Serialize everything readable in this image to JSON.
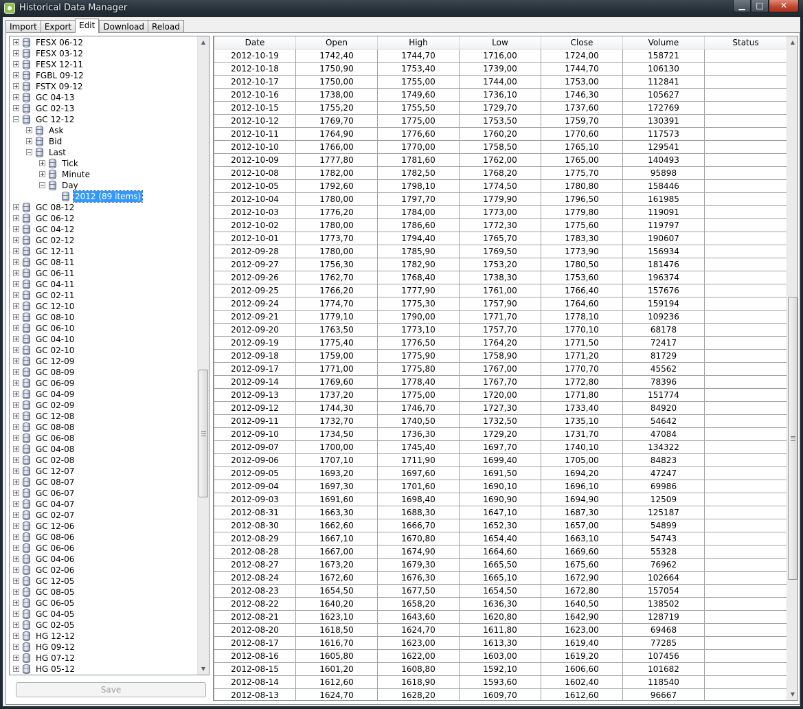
{
  "window": {
    "title": "Historical Data Manager",
    "min_glyph": "▁",
    "max_glyph": "□",
    "close_glyph": "✕"
  },
  "tabs": [
    {
      "label": "Import",
      "active": false
    },
    {
      "label": "Export",
      "active": false
    },
    {
      "label": "Edit",
      "active": true
    },
    {
      "label": "Download",
      "active": false
    },
    {
      "label": "Reload",
      "active": false
    }
  ],
  "tree": {
    "nodes": [
      {
        "label": "FESX 06-12",
        "level": 0,
        "expander": "plus"
      },
      {
        "label": "FESX 03-12",
        "level": 0,
        "expander": "plus"
      },
      {
        "label": "FESX 12-11",
        "level": 0,
        "expander": "plus"
      },
      {
        "label": "FGBL 09-12",
        "level": 0,
        "expander": "plus"
      },
      {
        "label": "FSTX 09-12",
        "level": 0,
        "expander": "plus"
      },
      {
        "label": "GC 04-13",
        "level": 0,
        "expander": "plus"
      },
      {
        "label": "GC 02-13",
        "level": 0,
        "expander": "plus"
      },
      {
        "label": "GC 12-12",
        "level": 0,
        "expander": "minus"
      },
      {
        "label": "Ask",
        "level": 1,
        "expander": "plus"
      },
      {
        "label": "Bid",
        "level": 1,
        "expander": "plus"
      },
      {
        "label": "Last",
        "level": 1,
        "expander": "minus"
      },
      {
        "label": "Tick",
        "level": 2,
        "expander": "plus"
      },
      {
        "label": "Minute",
        "level": 2,
        "expander": "plus"
      },
      {
        "label": "Day",
        "level": 2,
        "expander": "minus"
      },
      {
        "label": "2012 (89 items)",
        "level": 3,
        "expander": "none",
        "selected": true
      },
      {
        "label": "GC 08-12",
        "level": 0,
        "expander": "plus"
      },
      {
        "label": "GC 06-12",
        "level": 0,
        "expander": "plus"
      },
      {
        "label": "GC 04-12",
        "level": 0,
        "expander": "plus"
      },
      {
        "label": "GC 02-12",
        "level": 0,
        "expander": "plus"
      },
      {
        "label": "GC 12-11",
        "level": 0,
        "expander": "plus"
      },
      {
        "label": "GC 08-11",
        "level": 0,
        "expander": "plus"
      },
      {
        "label": "GC 06-11",
        "level": 0,
        "expander": "plus"
      },
      {
        "label": "GC 04-11",
        "level": 0,
        "expander": "plus"
      },
      {
        "label": "GC 02-11",
        "level": 0,
        "expander": "plus"
      },
      {
        "label": "GC 12-10",
        "level": 0,
        "expander": "plus"
      },
      {
        "label": "GC 08-10",
        "level": 0,
        "expander": "plus"
      },
      {
        "label": "GC 06-10",
        "level": 0,
        "expander": "plus"
      },
      {
        "label": "GC 04-10",
        "level": 0,
        "expander": "plus"
      },
      {
        "label": "GC 02-10",
        "level": 0,
        "expander": "plus"
      },
      {
        "label": "GC 12-09",
        "level": 0,
        "expander": "plus"
      },
      {
        "label": "GC 08-09",
        "level": 0,
        "expander": "plus"
      },
      {
        "label": "GC 06-09",
        "level": 0,
        "expander": "plus"
      },
      {
        "label": "GC 04-09",
        "level": 0,
        "expander": "plus"
      },
      {
        "label": "GC 02-09",
        "level": 0,
        "expander": "plus"
      },
      {
        "label": "GC 12-08",
        "level": 0,
        "expander": "plus"
      },
      {
        "label": "GC 08-08",
        "level": 0,
        "expander": "plus"
      },
      {
        "label": "GC 06-08",
        "level": 0,
        "expander": "plus"
      },
      {
        "label": "GC 04-08",
        "level": 0,
        "expander": "plus"
      },
      {
        "label": "GC 02-08",
        "level": 0,
        "expander": "plus"
      },
      {
        "label": "GC 12-07",
        "level": 0,
        "expander": "plus"
      },
      {
        "label": "GC 08-07",
        "level": 0,
        "expander": "plus"
      },
      {
        "label": "GC 06-07",
        "level": 0,
        "expander": "plus"
      },
      {
        "label": "GC 04-07",
        "level": 0,
        "expander": "plus"
      },
      {
        "label": "GC 02-07",
        "level": 0,
        "expander": "plus"
      },
      {
        "label": "GC 12-06",
        "level": 0,
        "expander": "plus"
      },
      {
        "label": "GC 08-06",
        "level": 0,
        "expander": "plus"
      },
      {
        "label": "GC 06-06",
        "level": 0,
        "expander": "plus"
      },
      {
        "label": "GC 04-06",
        "level": 0,
        "expander": "plus"
      },
      {
        "label": "GC 02-06",
        "level": 0,
        "expander": "plus"
      },
      {
        "label": "GC 12-05",
        "level": 0,
        "expander": "plus"
      },
      {
        "label": "GC 08-05",
        "level": 0,
        "expander": "plus"
      },
      {
        "label": "GC 06-05",
        "level": 0,
        "expander": "plus"
      },
      {
        "label": "GC 04-05",
        "level": 0,
        "expander": "plus"
      },
      {
        "label": "GC 02-05",
        "level": 0,
        "expander": "plus"
      },
      {
        "label": "HG 12-12",
        "level": 0,
        "expander": "plus"
      },
      {
        "label": "HG 09-12",
        "level": 0,
        "expander": "plus"
      },
      {
        "label": "HG 07-12",
        "level": 0,
        "expander": "plus"
      },
      {
        "label": "HG 05-12",
        "level": 0,
        "expander": "plus"
      }
    ]
  },
  "save_button": {
    "label": "Save",
    "enabled": false
  },
  "grid": {
    "columns": [
      "Date",
      "Open",
      "High",
      "Low",
      "Close",
      "Volume",
      "Status"
    ],
    "rows": [
      [
        "2012-10-19",
        "1742,40",
        "1744,70",
        "1716,00",
        "1724,00",
        "158721",
        ""
      ],
      [
        "2012-10-18",
        "1750,90",
        "1753,40",
        "1739,00",
        "1744,70",
        "106130",
        ""
      ],
      [
        "2012-10-17",
        "1750,00",
        "1755,00",
        "1744,00",
        "1753,00",
        "112841",
        ""
      ],
      [
        "2012-10-16",
        "1738,00",
        "1749,60",
        "1736,10",
        "1746,30",
        "105627",
        ""
      ],
      [
        "2012-10-15",
        "1755,20",
        "1755,50",
        "1729,70",
        "1737,60",
        "172769",
        ""
      ],
      [
        "2012-10-12",
        "1769,70",
        "1775,00",
        "1753,50",
        "1759,70",
        "130391",
        ""
      ],
      [
        "2012-10-11",
        "1764,90",
        "1776,60",
        "1760,20",
        "1770,60",
        "117573",
        ""
      ],
      [
        "2012-10-10",
        "1766,00",
        "1770,00",
        "1758,50",
        "1765,10",
        "129541",
        ""
      ],
      [
        "2012-10-09",
        "1777,80",
        "1781,60",
        "1762,00",
        "1765,00",
        "140493",
        ""
      ],
      [
        "2012-10-08",
        "1782,00",
        "1782,50",
        "1768,20",
        "1775,70",
        "95898",
        ""
      ],
      [
        "2012-10-05",
        "1792,60",
        "1798,10",
        "1774,50",
        "1780,80",
        "158446",
        ""
      ],
      [
        "2012-10-04",
        "1780,00",
        "1797,70",
        "1779,90",
        "1796,50",
        "161985",
        ""
      ],
      [
        "2012-10-03",
        "1776,20",
        "1784,00",
        "1773,00",
        "1779,80",
        "119091",
        ""
      ],
      [
        "2012-10-02",
        "1780,00",
        "1786,60",
        "1772,30",
        "1775,60",
        "119797",
        ""
      ],
      [
        "2012-10-01",
        "1773,70",
        "1794,40",
        "1765,70",
        "1783,30",
        "190607",
        ""
      ],
      [
        "2012-09-28",
        "1780,00",
        "1785,90",
        "1769,50",
        "1773,90",
        "156934",
        ""
      ],
      [
        "2012-09-27",
        "1756,30",
        "1782,90",
        "1753,20",
        "1780,50",
        "181476",
        ""
      ],
      [
        "2012-09-26",
        "1762,70",
        "1768,40",
        "1738,30",
        "1753,60",
        "196374",
        ""
      ],
      [
        "2012-09-25",
        "1766,20",
        "1777,90",
        "1761,00",
        "1766,40",
        "157676",
        ""
      ],
      [
        "2012-09-24",
        "1774,70",
        "1775,30",
        "1757,90",
        "1764,60",
        "159194",
        ""
      ],
      [
        "2012-09-21",
        "1779,10",
        "1790,00",
        "1771,70",
        "1778,10",
        "109236",
        ""
      ],
      [
        "2012-09-20",
        "1763,50",
        "1773,10",
        "1757,70",
        "1770,10",
        "68178",
        ""
      ],
      [
        "2012-09-19",
        "1775,40",
        "1776,50",
        "1764,20",
        "1771,50",
        "72417",
        ""
      ],
      [
        "2012-09-18",
        "1759,00",
        "1775,90",
        "1758,90",
        "1771,20",
        "81729",
        ""
      ],
      [
        "2012-09-17",
        "1771,00",
        "1775,80",
        "1767,00",
        "1770,70",
        "45562",
        ""
      ],
      [
        "2012-09-14",
        "1769,60",
        "1778,40",
        "1767,70",
        "1772,80",
        "78396",
        ""
      ],
      [
        "2012-09-13",
        "1737,20",
        "1775,00",
        "1720,00",
        "1771,80",
        "151774",
        ""
      ],
      [
        "2012-09-12",
        "1744,30",
        "1746,70",
        "1727,30",
        "1733,40",
        "84920",
        ""
      ],
      [
        "2012-09-11",
        "1732,70",
        "1740,50",
        "1732,50",
        "1735,10",
        "54642",
        ""
      ],
      [
        "2012-09-10",
        "1734,50",
        "1736,30",
        "1729,20",
        "1731,70",
        "47084",
        ""
      ],
      [
        "2012-09-07",
        "1700,00",
        "1745,40",
        "1697,70",
        "1740,10",
        "134322",
        ""
      ],
      [
        "2012-09-06",
        "1707,10",
        "1711,90",
        "1699,40",
        "1705,00",
        "84823",
        ""
      ],
      [
        "2012-09-05",
        "1693,20",
        "1697,60",
        "1691,50",
        "1694,20",
        "47247",
        ""
      ],
      [
        "2012-09-04",
        "1697,30",
        "1701,60",
        "1690,10",
        "1696,10",
        "69986",
        ""
      ],
      [
        "2012-09-03",
        "1691,60",
        "1698,40",
        "1690,90",
        "1694,90",
        "12509",
        ""
      ],
      [
        "2012-08-31",
        "1663,30",
        "1688,30",
        "1647,10",
        "1687,30",
        "125187",
        ""
      ],
      [
        "2012-08-30",
        "1662,60",
        "1666,70",
        "1652,30",
        "1657,00",
        "54899",
        ""
      ],
      [
        "2012-08-29",
        "1667,10",
        "1670,80",
        "1654,40",
        "1663,10",
        "54743",
        ""
      ],
      [
        "2012-08-28",
        "1667,00",
        "1674,90",
        "1664,60",
        "1669,60",
        "55328",
        ""
      ],
      [
        "2012-08-27",
        "1673,20",
        "1679,30",
        "1665,50",
        "1675,60",
        "76962",
        ""
      ],
      [
        "2012-08-24",
        "1672,60",
        "1676,30",
        "1665,10",
        "1672,90",
        "102664",
        ""
      ],
      [
        "2012-08-23",
        "1654,50",
        "1677,50",
        "1654,50",
        "1672,80",
        "157054",
        ""
      ],
      [
        "2012-08-22",
        "1640,20",
        "1658,20",
        "1636,30",
        "1640,50",
        "138502",
        ""
      ],
      [
        "2012-08-21",
        "1623,10",
        "1643,60",
        "1620,80",
        "1642,90",
        "128719",
        ""
      ],
      [
        "2012-08-20",
        "1618,50",
        "1624,70",
        "1611,80",
        "1623,00",
        "69468",
        ""
      ],
      [
        "2012-08-17",
        "1616,70",
        "1623,00",
        "1613,30",
        "1619,40",
        "77285",
        ""
      ],
      [
        "2012-08-16",
        "1605,80",
        "1622,00",
        "1603,00",
        "1619,20",
        "107456",
        ""
      ],
      [
        "2012-08-15",
        "1601,20",
        "1608,80",
        "1592,10",
        "1606,60",
        "101682",
        ""
      ],
      [
        "2012-08-14",
        "1612,60",
        "1618,90",
        "1593,60",
        "1602,40",
        "118540",
        ""
      ],
      [
        "2012-08-13",
        "1624,70",
        "1628,20",
        "1609,70",
        "1612,60",
        "96667",
        ""
      ]
    ]
  },
  "icons": {
    "scroll_up": "▲",
    "scroll_down": "▼",
    "tree_item_icon": "database-icon",
    "app_icon": "app-icon"
  },
  "colors": {
    "selection": "#3399ff",
    "window_background": "#f0f0f0",
    "grid_lines": "#a0a0a0"
  }
}
